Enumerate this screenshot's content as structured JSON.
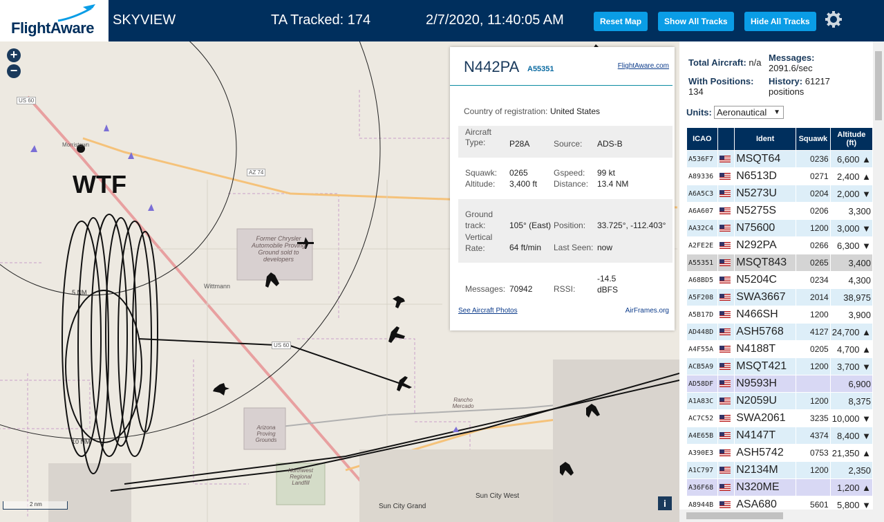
{
  "header": {
    "logo": "FlightAware",
    "app": "SKYVIEW",
    "tracked": "TA Tracked: 174",
    "datetime": "2/7/2020, 11:40:05 AM",
    "buttons": {
      "reset": "Reset Map",
      "show": "Show All Tracks",
      "hide": "Hide All Tracks"
    }
  },
  "map": {
    "labels": {
      "wtf": "WTF",
      "us60a": "US 60",
      "us60b": "US 60",
      "az74": "AZ 74",
      "morristown": "Morristown",
      "wittmann": "Wittmann",
      "ring5": "5 NM",
      "ring10": "10 NM",
      "chrysler": "Former Chrysler Automobile Proving Ground sold to developers",
      "arizona": "Arizona Proving Grounds",
      "rancho": "Rancho Mercado",
      "landfill": "Northwest Regional Landfill",
      "suncitywest": "Sun City West",
      "suncitygrand": "Sun City Grand",
      "scale": "2 nm"
    }
  },
  "info": {
    "callsign": "N442PA",
    "hex": "A55351",
    "fa_link": "FlightAware.com",
    "country_label": "Country of registration:",
    "country": "United States",
    "aircraft_type_label": "Aircraft Type:",
    "aircraft_type": "P28A",
    "source_label": "Source:",
    "source": "ADS-B",
    "squawk_label": "Squawk:",
    "squawk": "0265",
    "gspeed_label": "Gspeed:",
    "gspeed": "99 kt",
    "altitude_label": "Altitude:",
    "altitude": "3,400 ft",
    "distance_label": "Distance:",
    "distance": "13.4 NM",
    "track_label": "Ground track:",
    "track": "105° (East)",
    "position_label": "Position:",
    "position": "33.725°, -112.403°",
    "vrate_label": "Vertical Rate:",
    "vrate": "64 ft/min",
    "lastseen_label": "Last Seen:",
    "lastseen": "now",
    "messages_label": "Messages:",
    "messages": "70942",
    "rssi_label": "RSSI:",
    "rssi": "-14.5 dBFS",
    "photos_link": "See Aircraft Photos",
    "airframes_link": "AirFrames.org"
  },
  "sidebar": {
    "total_label": "Total Aircraft:",
    "total": "n/a",
    "messages_label": "Messages:",
    "messages": "2091.6/sec",
    "withpos_label": "With Positions:",
    "withpos": "134",
    "history_label": "History:",
    "history": "61217 positions",
    "units_label": "Units:",
    "units_value": "Aeronautical",
    "columns": [
      "ICAO",
      "",
      "Ident",
      "Squawk",
      "Altitude (ft)"
    ],
    "rows": [
      {
        "icao": "A536F7",
        "ident": "MSQT64",
        "squawk": "0236",
        "alt": "6,600 ▲",
        "style": "even"
      },
      {
        "icao": "A89336",
        "ident": "N6513D",
        "squawk": "0271",
        "alt": "2,400 ▲",
        "style": "odd"
      },
      {
        "icao": "A6A5C3",
        "ident": "N5273U",
        "squawk": "0204",
        "alt": "2,000 ▼",
        "style": "even"
      },
      {
        "icao": "A6A607",
        "ident": "N5275S",
        "squawk": "0206",
        "alt": "3,300",
        "style": "odd"
      },
      {
        "icao": "AA32C4",
        "ident": "N75600",
        "squawk": "1200",
        "alt": "3,000 ▼",
        "style": "even"
      },
      {
        "icao": "A2FE2E",
        "ident": "N292PA",
        "squawk": "0266",
        "alt": "6,300 ▼",
        "style": "odd"
      },
      {
        "icao": "A55351",
        "ident": "MSQT843",
        "squawk": "0265",
        "alt": "3,400",
        "style": "sel"
      },
      {
        "icao": "A68BD5",
        "ident": "N5204C",
        "squawk": "0234",
        "alt": "4,300",
        "style": "odd"
      },
      {
        "icao": "A5F208",
        "ident": "SWA3667",
        "squawk": "2014",
        "alt": "38,975",
        "style": "even"
      },
      {
        "icao": "A5B17D",
        "ident": "N466SH",
        "squawk": "1200",
        "alt": "3,900",
        "style": "odd"
      },
      {
        "icao": "AD448D",
        "ident": "ASH5768",
        "squawk": "4127",
        "alt": "24,700 ▲",
        "style": "even"
      },
      {
        "icao": "A4F55A",
        "ident": "N4188T",
        "squawk": "0205",
        "alt": "4,700 ▲",
        "style": "odd"
      },
      {
        "icao": "ACB5A9",
        "ident": "MSQT421",
        "squawk": "1200",
        "alt": "3,700 ▼",
        "style": "even"
      },
      {
        "icao": "AD58DF",
        "ident": "N9593H",
        "squawk": "",
        "alt": "6,900",
        "style": "mlat"
      },
      {
        "icao": "A1A83C",
        "ident": "N2059U",
        "squawk": "1200",
        "alt": "8,375",
        "style": "even"
      },
      {
        "icao": "AC7C52",
        "ident": "SWA2061",
        "squawk": "3235",
        "alt": "10,000 ▼",
        "style": "odd"
      },
      {
        "icao": "A4E65B",
        "ident": "N4147T",
        "squawk": "4374",
        "alt": "8,400 ▼",
        "style": "even"
      },
      {
        "icao": "A390E3",
        "ident": "ASH5742",
        "squawk": "0753",
        "alt": "21,350 ▲",
        "style": "odd"
      },
      {
        "icao": "A1C797",
        "ident": "N2134M",
        "squawk": "1200",
        "alt": "2,350",
        "style": "even"
      },
      {
        "icao": "A36F68",
        "ident": "N320ME",
        "squawk": "",
        "alt": "1,200 ▲",
        "style": "mlat"
      },
      {
        "icao": "A8944B",
        "ident": "ASA680",
        "squawk": "5601",
        "alt": "5,800 ▼",
        "style": "odd"
      }
    ]
  }
}
